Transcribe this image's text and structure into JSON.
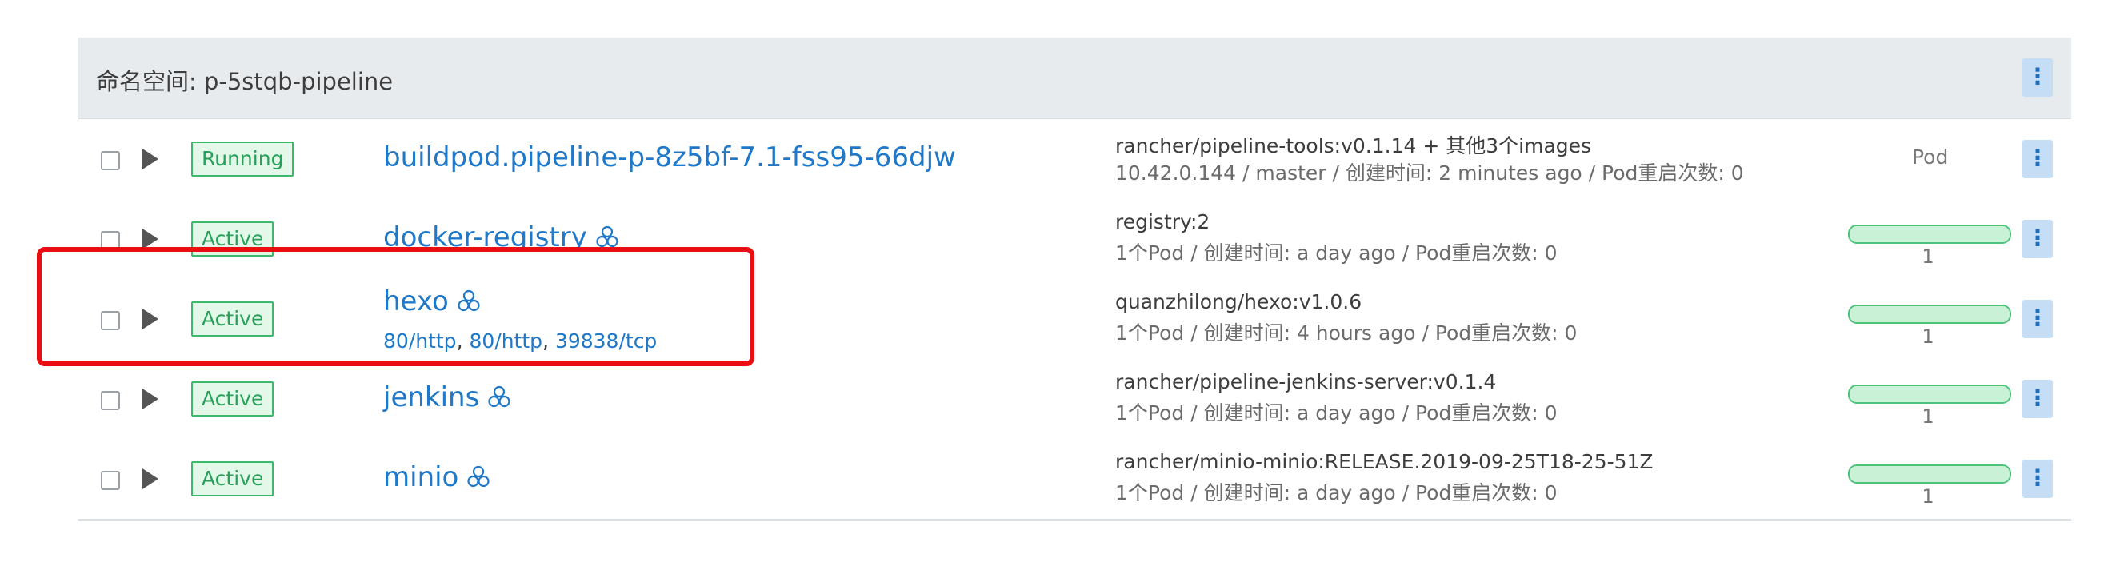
{
  "namespace": {
    "title": "命名空间: p-5stqb-pipeline",
    "menu_icon": "kebab-icon"
  },
  "rows": [
    {
      "status": "Running",
      "name": "buildpod.pipeline-p-8z5bf-7.1-fss95-66djw",
      "image": "rancher/pipeline-tools:v0.1.14 + 其他3个images",
      "meta": "10.42.0.144 / master / 创建时间: 2 minutes ago / Pod重启次数: 0",
      "kind": "Pod"
    },
    {
      "status": "Active",
      "name": "docker-registry",
      "image": "registry:2",
      "meta": "1个Pod / 创建时间: a day ago / Pod重启次数: 0",
      "scale": {
        "count": "1",
        "progress": 1.0
      }
    },
    {
      "status": "Active",
      "name": "hexo",
      "ports": [
        "80/http",
        "80/http",
        "39838/tcp"
      ],
      "image": "quanzhilong/hexo:v1.0.6",
      "meta": "1个Pod / 创建时间: 4 hours ago / Pod重启次数: 0",
      "scale": {
        "count": "1",
        "progress": 1.0
      }
    },
    {
      "status": "Active",
      "name": "jenkins",
      "image": "rancher/pipeline-jenkins-server:v0.1.4",
      "meta": "1个Pod / 创建时间: a day ago / Pod重启次数: 0",
      "scale": {
        "count": "1",
        "progress": 1.0
      }
    },
    {
      "status": "Active",
      "name": "minio",
      "image": "rancher/minio-minio:RELEASE.2019-09-25T18-25-51Z",
      "meta": "1个Pod / 创建时间: a day ago / Pod重启次数: 0",
      "scale": {
        "count": "1",
        "progress": 1.0
      }
    }
  ],
  "colors": {
    "accent": "#1f78c8",
    "active_green": "#27a159",
    "highlight_red": "#ea0d12",
    "header_bg": "#e8ebed"
  },
  "icons": {
    "workload": "workload-cluster-icon",
    "expand": "expand-triangle-icon",
    "menu": "kebab-icon"
  }
}
